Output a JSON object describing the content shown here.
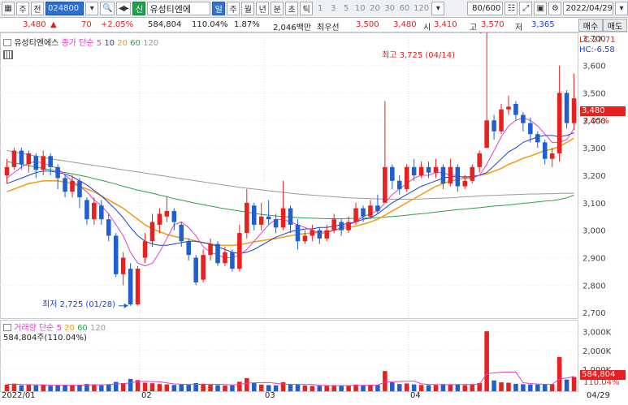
{
  "toolbar": {
    "code": "024800",
    "name": "유성티엔에",
    "market_badge": "신",
    "periods": [
      "일",
      "주",
      "월",
      "년",
      "분",
      "초",
      "틱"
    ],
    "selected_period": "일",
    "intervals": [
      "1",
      "3",
      "5",
      "10",
      "20",
      "30",
      "60",
      "120"
    ],
    "count": "80/600",
    "date": "2022/04/29",
    "left_buttons": [
      "주",
      "전"
    ]
  },
  "quote": {
    "price": "3,480",
    "arrow": "▲",
    "change": "70",
    "change_pct": "+2.05%",
    "volume": "584,804",
    "volume_ratio": "110.04%",
    "turnover": "1.87%",
    "amount": "2,046백만",
    "preferred_label": "최우선",
    "ask": "3,500",
    "bid": "3,480",
    "open_label": "시",
    "open": "3,410",
    "high_label": "고",
    "high": "3,570",
    "low_label": "저",
    "low": "3,365"
  },
  "buttons": {
    "buy": "매수",
    "sell": "매도"
  },
  "price_panel": {
    "legend_name": "유성티엔에스",
    "legend_ma_title": "종가 단순",
    "ma_periods": [
      "5",
      "10",
      "20",
      "60",
      "120"
    ],
    "lc": "LC:27.71",
    "hc": "HC:-6.58",
    "last_price": "3,480",
    "last_pct": "2.05%",
    "high_annotation": "최고 3,725 (04/14)",
    "low_annotation": "최저 2,725 (01/28)"
  },
  "volume_panel": {
    "legend_name": "거래량",
    "legend_ma_title": "단순",
    "ma_periods": [
      "5",
      "20",
      "60",
      "120"
    ],
    "info": "584,804주(110.04%)",
    "last_volume": "584,804",
    "last_pct": "110.04%"
  },
  "colors": {
    "up": "#e8201f",
    "down": "#1f5fd0",
    "ma5": "#e040c8",
    "ma10": "#1a3fd0",
    "ma20": "#f0a020",
    "ma60": "#2ea04a",
    "ma120": "#9a9a9a"
  },
  "x_labels": [
    "2022/01",
    "02",
    "03",
    "04",
    "04/29"
  ],
  "chart_data": {
    "type": "candlestick",
    "y_ticks": [
      2700,
      2800,
      2900,
      3000,
      3100,
      3200,
      3300,
      3400,
      3500,
      3600,
      3700
    ],
    "ylim": [
      2680,
      3720
    ],
    "vol_ticks": [
      "1,000K",
      "2,000K",
      "3,000K"
    ],
    "vol_ylim": [
      0,
      3200
    ],
    "candles": [
      [
        3200,
        3230,
        3260,
        3170,
        180
      ],
      [
        3230,
        3290,
        3300,
        3220,
        230
      ],
      [
        3290,
        3240,
        3300,
        3220,
        140
      ],
      [
        3240,
        3280,
        3290,
        3210,
        160
      ],
      [
        3270,
        3220,
        3280,
        3190,
        140
      ],
      [
        3220,
        3270,
        3290,
        3200,
        170
      ],
      [
        3270,
        3230,
        3280,
        3200,
        120
      ],
      [
        3230,
        3190,
        3240,
        3150,
        150
      ],
      [
        3190,
        3140,
        3200,
        3120,
        160
      ],
      [
        3140,
        3180,
        3200,
        3120,
        130
      ],
      [
        3180,
        3120,
        3190,
        3080,
        170
      ],
      [
        3110,
        3040,
        3120,
        3020,
        210
      ],
      [
        3040,
        3100,
        3120,
        3020,
        190
      ],
      [
        3090,
        3040,
        3110,
        3020,
        140
      ],
      [
        3040,
        2980,
        3060,
        2960,
        190
      ],
      [
        2980,
        2840,
        2990,
        2830,
        320
      ],
      [
        2840,
        2900,
        2920,
        2800,
        260
      ],
      [
        2860,
        2730,
        2880,
        2725,
        480
      ],
      [
        2730,
        2860,
        2870,
        2725,
        420
      ],
      [
        2900,
        2960,
        2990,
        2880,
        280
      ],
      [
        2960,
        3030,
        3060,
        2940,
        250
      ],
      [
        3020,
        3060,
        3080,
        2990,
        210
      ],
      [
        3050,
        3070,
        3120,
        3030,
        190
      ],
      [
        3070,
        3030,
        3080,
        3000,
        160
      ],
      [
        3020,
        2960,
        3030,
        2940,
        180
      ],
      [
        2960,
        2910,
        2970,
        2890,
        170
      ],
      [
        2900,
        2810,
        2910,
        2800,
        260
      ],
      [
        2820,
        2910,
        2930,
        2810,
        220
      ],
      [
        2910,
        2950,
        2970,
        2890,
        170
      ],
      [
        2950,
        2880,
        2960,
        2870,
        150
      ],
      [
        2880,
        2920,
        2940,
        2870,
        130
      ],
      [
        2920,
        2860,
        2930,
        2850,
        140
      ],
      [
        2860,
        2990,
        3020,
        2850,
        330
      ],
      [
        2990,
        3100,
        3150,
        2970,
        520
      ],
      [
        3090,
        3020,
        3100,
        3000,
        260
      ],
      [
        3020,
        3050,
        3100,
        3000,
        180
      ],
      [
        3050,
        3040,
        3110,
        3020,
        150
      ],
      [
        3040,
        3010,
        3060,
        2990,
        140
      ],
      [
        3010,
        3080,
        3180,
        3000,
        310
      ],
      [
        3080,
        3020,
        3090,
        2990,
        190
      ],
      [
        3020,
        2960,
        3040,
        2930,
        170
      ],
      [
        2960,
        2980,
        3000,
        2950,
        130
      ],
      [
        2980,
        3000,
        3020,
        2960,
        110
      ],
      [
        3000,
        2970,
        3010,
        2950,
        120
      ],
      [
        2970,
        3000,
        3020,
        2960,
        120
      ],
      [
        3000,
        3040,
        3060,
        2990,
        150
      ],
      [
        3030,
        3000,
        3040,
        2980,
        120
      ],
      [
        3000,
        3030,
        3050,
        2990,
        120
      ],
      [
        3030,
        3080,
        3100,
        3020,
        180
      ],
      [
        3080,
        3050,
        3090,
        3030,
        140
      ],
      [
        3050,
        3090,
        3110,
        3040,
        170
      ],
      [
        3090,
        3070,
        3130,
        3060,
        160
      ],
      [
        3100,
        3230,
        3470,
        3100,
        900
      ],
      [
        3230,
        3180,
        3240,
        3150,
        300
      ],
      [
        3180,
        3150,
        3200,
        3130,
        210
      ],
      [
        3150,
        3230,
        3240,
        3140,
        240
      ],
      [
        3230,
        3200,
        3260,
        3180,
        190
      ],
      [
        3200,
        3230,
        3250,
        3190,
        160
      ],
      [
        3230,
        3210,
        3250,
        3190,
        150
      ],
      [
        3210,
        3230,
        3260,
        3190,
        150
      ],
      [
        3230,
        3170,
        3240,
        3150,
        210
      ],
      [
        3170,
        3230,
        3260,
        3160,
        200
      ],
      [
        3230,
        3160,
        3240,
        3140,
        190
      ],
      [
        3160,
        3180,
        3200,
        3150,
        150
      ],
      [
        3180,
        3230,
        3240,
        3170,
        180
      ],
      [
        3230,
        3280,
        3290,
        3210,
        260
      ],
      [
        3300,
        3400,
        3720,
        3300,
        3020
      ],
      [
        3400,
        3360,
        3420,
        3330,
        400
      ],
      [
        3360,
        3440,
        3460,
        3350,
        300
      ],
      [
        3440,
        3450,
        3490,
        3420,
        280
      ],
      [
        3460,
        3420,
        3470,
        3400,
        220
      ],
      [
        3420,
        3390,
        3430,
        3360,
        200
      ],
      [
        3390,
        3350,
        3410,
        3320,
        190
      ],
      [
        3350,
        3320,
        3360,
        3300,
        180
      ],
      [
        3320,
        3260,
        3330,
        3240,
        190
      ],
      [
        3260,
        3280,
        3300,
        3230,
        200
      ],
      [
        3280,
        3500,
        3600,
        3250,
        1650
      ],
      [
        3500,
        3390,
        3510,
        3370,
        450
      ],
      [
        3390,
        3480,
        3570,
        3365,
        585
      ]
    ],
    "ma5": [
      3190,
      3210,
      3230,
      3245,
      3250,
      3245,
      3235,
      3225,
      3200,
      3180,
      3160,
      3140,
      3110,
      3090,
      3060,
      3020,
      2980,
      2920,
      2880,
      2870,
      2880,
      2920,
      2970,
      3020,
      3030,
      3010,
      2980,
      2940,
      2920,
      2910,
      2900,
      2900,
      2910,
      2930,
      2960,
      2990,
      3020,
      3040,
      3040,
      3030,
      3020,
      3010,
      3000,
      2990,
      2990,
      3000,
      3010,
      3020,
      3030,
      3050,
      3060,
      3070,
      3100,
      3130,
      3150,
      3170,
      3190,
      3200,
      3200,
      3210,
      3210,
      3200,
      3200,
      3190,
      3190,
      3200,
      3240,
      3290,
      3340,
      3380,
      3400,
      3410,
      3400,
      3380,
      3350,
      3320,
      3320,
      3330,
      3370
    ],
    "ma10": [
      3170,
      3180,
      3190,
      3200,
      3210,
      3215,
      3215,
      3210,
      3205,
      3195,
      3180,
      3165,
      3145,
      3125,
      3100,
      3075,
      3045,
      3010,
      2980,
      2960,
      2950,
      2945,
      2945,
      2950,
      2955,
      2960,
      2960,
      2955,
      2950,
      2940,
      2930,
      2920,
      2915,
      2920,
      2930,
      2945,
      2960,
      2975,
      2985,
      2995,
      3000,
      3005,
      3005,
      3010,
      3010,
      3015,
      3020,
      3025,
      3030,
      3040,
      3045,
      3060,
      3080,
      3100,
      3115,
      3130,
      3145,
      3160,
      3170,
      3180,
      3190,
      3195,
      3195,
      3195,
      3195,
      3200,
      3210,
      3235,
      3260,
      3285,
      3300,
      3320,
      3330,
      3340,
      3345,
      3345,
      3340,
      3345,
      3355
    ],
    "ma20": [
      3140,
      3150,
      3160,
      3170,
      3175,
      3180,
      3180,
      3180,
      3175,
      3170,
      3160,
      3150,
      3140,
      3125,
      3110,
      3095,
      3080,
      3060,
      3040,
      3020,
      3005,
      2995,
      2985,
      2978,
      2972,
      2968,
      2960,
      2955,
      2950,
      2945,
      2945,
      2945,
      2948,
      2952,
      2958,
      2962,
      2966,
      2970,
      2975,
      2980,
      2985,
      2988,
      2990,
      2993,
      2996,
      3000,
      3005,
      3010,
      3015,
      3022,
      3030,
      3040,
      3055,
      3070,
      3085,
      3100,
      3115,
      3130,
      3145,
      3160,
      3170,
      3180,
      3185,
      3190,
      3195,
      3200,
      3205,
      3215,
      3225,
      3240,
      3250,
      3262,
      3270,
      3280,
      3290,
      3295,
      3305,
      3320,
      3335
    ],
    "ma60": [
      3250,
      3245,
      3240,
      3235,
      3230,
      3225,
      3220,
      3215,
      3210,
      3205,
      3200,
      3195,
      3188,
      3182,
      3175,
      3168,
      3160,
      3153,
      3146,
      3140,
      3135,
      3128,
      3122,
      3115,
      3110,
      3104,
      3098,
      3093,
      3088,
      3083,
      3078,
      3074,
      3070,
      3066,
      3062,
      3058,
      3055,
      3052,
      3050,
      3048,
      3046,
      3045,
      3044,
      3043,
      3042,
      3042,
      3042,
      3043,
      3043,
      3044,
      3045,
      3046,
      3048,
      3050,
      3052,
      3055,
      3058,
      3060,
      3063,
      3066,
      3069,
      3072,
      3075,
      3077,
      3080,
      3082,
      3085,
      3088,
      3090,
      3092,
      3095,
      3098,
      3100,
      3103,
      3106,
      3108,
      3112,
      3118,
      3128
    ],
    "ma120": [
      3290,
      3285,
      3280,
      3275,
      3270,
      3265,
      3260,
      3256,
      3252,
      3248,
      3244,
      3240,
      3236,
      3232,
      3228,
      3224,
      3220,
      3216,
      3212,
      3208,
      3204,
      3200,
      3196,
      3192,
      3188,
      3184,
      3180,
      3176,
      3172,
      3168,
      3164,
      3160,
      3156,
      3153,
      3150,
      3147,
      3144,
      3141,
      3138,
      3135,
      3132,
      3130,
      3128,
      3126,
      3124,
      3122,
      3120,
      3118,
      3117,
      3116,
      3115,
      3114,
      3113,
      3113,
      3113,
      3113,
      3113,
      3114,
      3115,
      3116,
      3117,
      3118,
      3120,
      3122,
      3123,
      3125,
      3126,
      3127,
      3128,
      3129,
      3130,
      3131,
      3132,
      3132,
      3133,
      3133,
      3134,
      3134,
      3135
    ]
  }
}
